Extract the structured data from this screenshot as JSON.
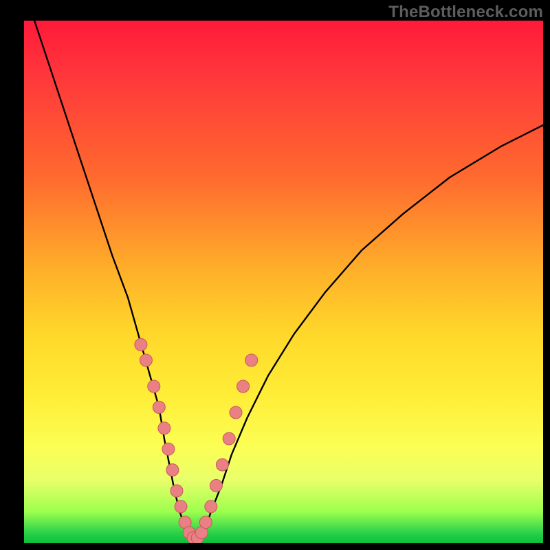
{
  "watermark": "TheBottleneck.com",
  "chart_data": {
    "type": "line",
    "title": "",
    "xlabel": "",
    "ylabel": "",
    "xlim": [
      0,
      100
    ],
    "ylim": [
      0,
      100
    ],
    "series": [
      {
        "name": "curve",
        "x": [
          2,
          5,
          8,
          11,
          14,
          17,
          20,
          22,
          24,
          26,
          27,
          28,
          29,
          30,
          31,
          32,
          33,
          34,
          35,
          36,
          38,
          40,
          43,
          47,
          52,
          58,
          65,
          73,
          82,
          92,
          100
        ],
        "y": [
          100,
          91,
          82,
          73,
          64,
          55,
          47,
          40,
          33,
          26,
          20,
          15,
          10,
          6,
          3,
          1,
          0,
          1,
          3,
          6,
          11,
          17,
          24,
          32,
          40,
          48,
          56,
          63,
          70,
          76,
          80
        ]
      }
    ],
    "markers": {
      "name": "pink-dots",
      "x": [
        22.5,
        23.5,
        25,
        26,
        27,
        27.8,
        28.6,
        29.4,
        30.2,
        31,
        31.8,
        32.6,
        33.4,
        34.2,
        35,
        36,
        37,
        38.2,
        39.5,
        40.8,
        42.2,
        43.8
      ],
      "y": [
        38,
        35,
        30,
        26,
        22,
        18,
        14,
        10,
        7,
        4,
        2,
        1,
        1,
        2,
        4,
        7,
        11,
        15,
        20,
        25,
        30,
        35
      ]
    },
    "colors": {
      "curve": "#000000",
      "marker_fill": "#e98083",
      "marker_stroke": "#c9575b"
    }
  }
}
